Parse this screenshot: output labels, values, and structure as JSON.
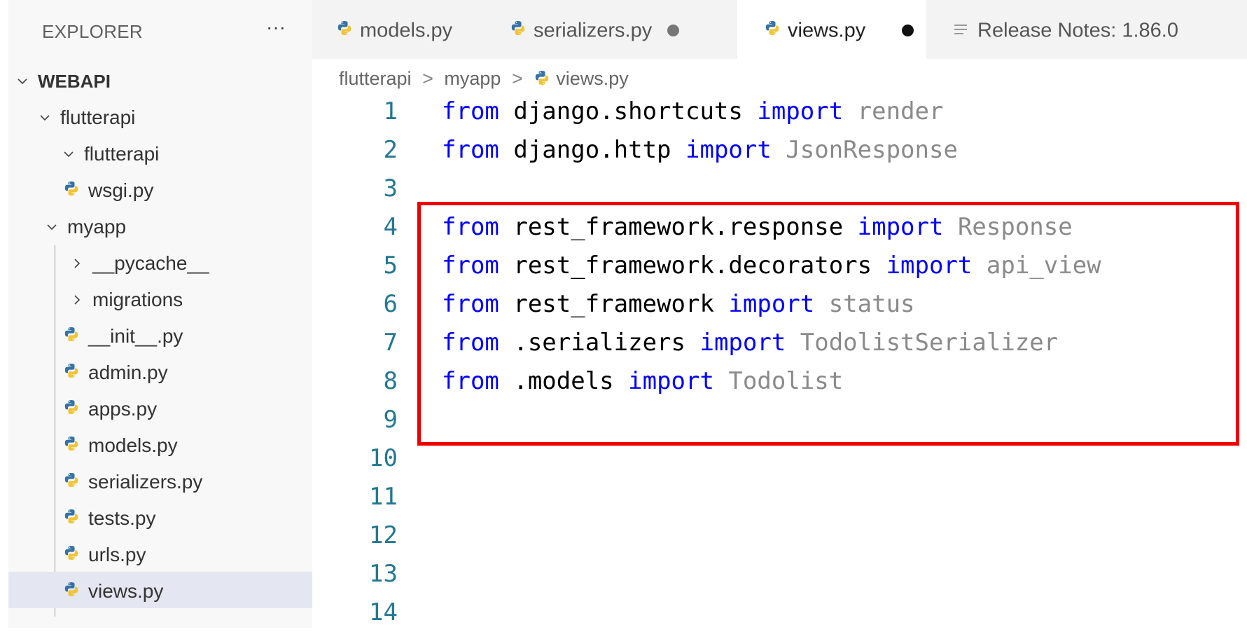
{
  "explorer": {
    "title": "EXPLORER",
    "more": "···",
    "tree": [
      {
        "label": "WEBAPI",
        "kind": "folder-open",
        "root": true
      },
      {
        "label": "flutterapi",
        "kind": "folder-open"
      },
      {
        "label": "flutterapi",
        "kind": "folder-open"
      },
      {
        "label": "wsgi.py",
        "kind": "python-file"
      },
      {
        "label": "myapp",
        "kind": "folder-open"
      },
      {
        "label": "__pycache__",
        "kind": "folder-closed"
      },
      {
        "label": "migrations",
        "kind": "folder-closed"
      },
      {
        "label": "__init__.py",
        "kind": "python-file"
      },
      {
        "label": "admin.py",
        "kind": "python-file"
      },
      {
        "label": "apps.py",
        "kind": "python-file"
      },
      {
        "label": "models.py",
        "kind": "python-file"
      },
      {
        "label": "serializers.py",
        "kind": "python-file"
      },
      {
        "label": "tests.py",
        "kind": "python-file"
      },
      {
        "label": "urls.py",
        "kind": "python-file"
      },
      {
        "label": "views.py",
        "kind": "python-file",
        "selected": true
      }
    ]
  },
  "tabs": [
    {
      "label": "models.py",
      "icon": "python-icon",
      "dirty": false,
      "active": false
    },
    {
      "label": "serializers.py",
      "icon": "python-icon",
      "dirty": true,
      "active": false
    },
    {
      "label": "views.py",
      "icon": "python-icon",
      "dirty": true,
      "active": true
    },
    {
      "label": "Release Notes: 1.86.0",
      "icon": "lines-icon",
      "dirty": false,
      "active": false
    }
  ],
  "breadcrumb": {
    "parts": [
      "flutterapi",
      "myapp",
      "views.py"
    ],
    "separator": ">"
  },
  "editor": {
    "lines": [
      {
        "n": "1",
        "tokens": [
          [
            "kw",
            "from"
          ],
          [
            "t",
            " django.shortcuts "
          ],
          [
            "kw",
            "import"
          ],
          [
            "dim",
            " render"
          ]
        ]
      },
      {
        "n": "2",
        "tokens": [
          [
            "kw",
            "from"
          ],
          [
            "t",
            " django.http "
          ],
          [
            "kw",
            "import"
          ],
          [
            "dim",
            " JsonResponse"
          ]
        ]
      },
      {
        "n": "3",
        "tokens": []
      },
      {
        "n": "4",
        "tokens": [
          [
            "kw",
            "from"
          ],
          [
            "t",
            " rest_framework.response "
          ],
          [
            "kw",
            "import"
          ],
          [
            "dim",
            " Response"
          ]
        ]
      },
      {
        "n": "5",
        "tokens": [
          [
            "kw",
            "from"
          ],
          [
            "t",
            " rest_framework.decorators "
          ],
          [
            "kw",
            "import"
          ],
          [
            "dim",
            " api_view"
          ]
        ]
      },
      {
        "n": "6",
        "tokens": [
          [
            "kw",
            "from"
          ],
          [
            "t",
            " rest_framework "
          ],
          [
            "kw",
            "import"
          ],
          [
            "dim",
            " status"
          ]
        ]
      },
      {
        "n": "7",
        "tokens": [
          [
            "kw",
            "from"
          ],
          [
            "t",
            " .serializers "
          ],
          [
            "kw",
            "import"
          ],
          [
            "dim",
            " TodolistSerializer"
          ]
        ]
      },
      {
        "n": "8",
        "tokens": [
          [
            "kw",
            "from"
          ],
          [
            "t",
            " .models "
          ],
          [
            "kw",
            "import"
          ],
          [
            "dim",
            " Todolist"
          ]
        ]
      },
      {
        "n": "9",
        "tokens": []
      },
      {
        "n": "10",
        "tokens": []
      },
      {
        "n": "11",
        "tokens": []
      },
      {
        "n": "12",
        "tokens": []
      },
      {
        "n": "13",
        "tokens": []
      },
      {
        "n": "14",
        "tokens": []
      }
    ]
  },
  "colors": {
    "keyword": "#0000ff",
    "unused_import": "#8a8a8a",
    "line_number": "#237893",
    "highlight_box": "#ee0000",
    "python_blue": "#3572a5",
    "python_yellow": "#f2c434"
  }
}
